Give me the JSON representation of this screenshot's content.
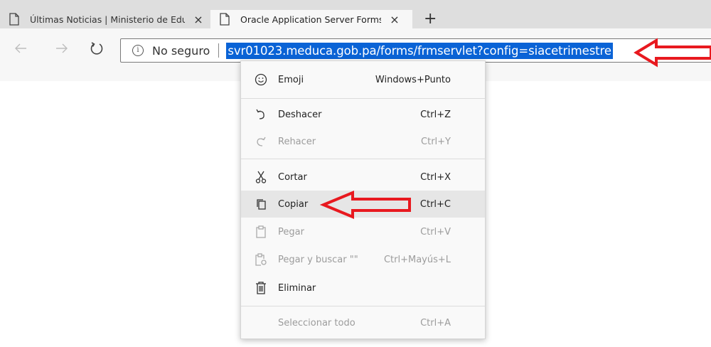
{
  "tabs": [
    {
      "title": "Últimas Noticias | Ministerio de Educación",
      "close": "×",
      "active": false
    },
    {
      "title": "Oracle Application Server Forms Services",
      "close": "×",
      "active": true
    }
  ],
  "new_tab": "+",
  "nav": {
    "security_label": "No seguro",
    "url": "svr01023.meduca.gob.pa/forms/frmservlet?config=siacetrimestre"
  },
  "context_menu": {
    "items": [
      {
        "label": "Emoji",
        "shortcut": "Windows+Punto",
        "icon": "emoji-icon",
        "enabled": true
      },
      {
        "label": "Deshacer",
        "shortcut": "Ctrl+Z",
        "icon": "undo-icon",
        "enabled": true
      },
      {
        "label": "Rehacer",
        "shortcut": "Ctrl+Y",
        "icon": "redo-icon",
        "enabled": false
      },
      {
        "label": "Cortar",
        "shortcut": "Ctrl+X",
        "icon": "scissors-icon",
        "enabled": true
      },
      {
        "label": "Copiar",
        "shortcut": "Ctrl+C",
        "icon": "copy-icon",
        "enabled": true,
        "highlighted": true
      },
      {
        "label": "Pegar",
        "shortcut": "Ctrl+V",
        "icon": "paste-icon",
        "enabled": false
      },
      {
        "label": "Pegar y buscar \"\"",
        "shortcut": "Ctrl+Mayús+L",
        "icon": "paste-search-icon",
        "enabled": false
      },
      {
        "label": "Eliminar",
        "shortcut": "",
        "icon": "trash-icon",
        "enabled": true
      },
      {
        "label": "Seleccionar todo",
        "shortcut": "Ctrl+A",
        "icon": "",
        "enabled": false
      }
    ]
  },
  "colors": {
    "annotation_arrow": "#e8191f",
    "selection": "#0a63d6"
  }
}
